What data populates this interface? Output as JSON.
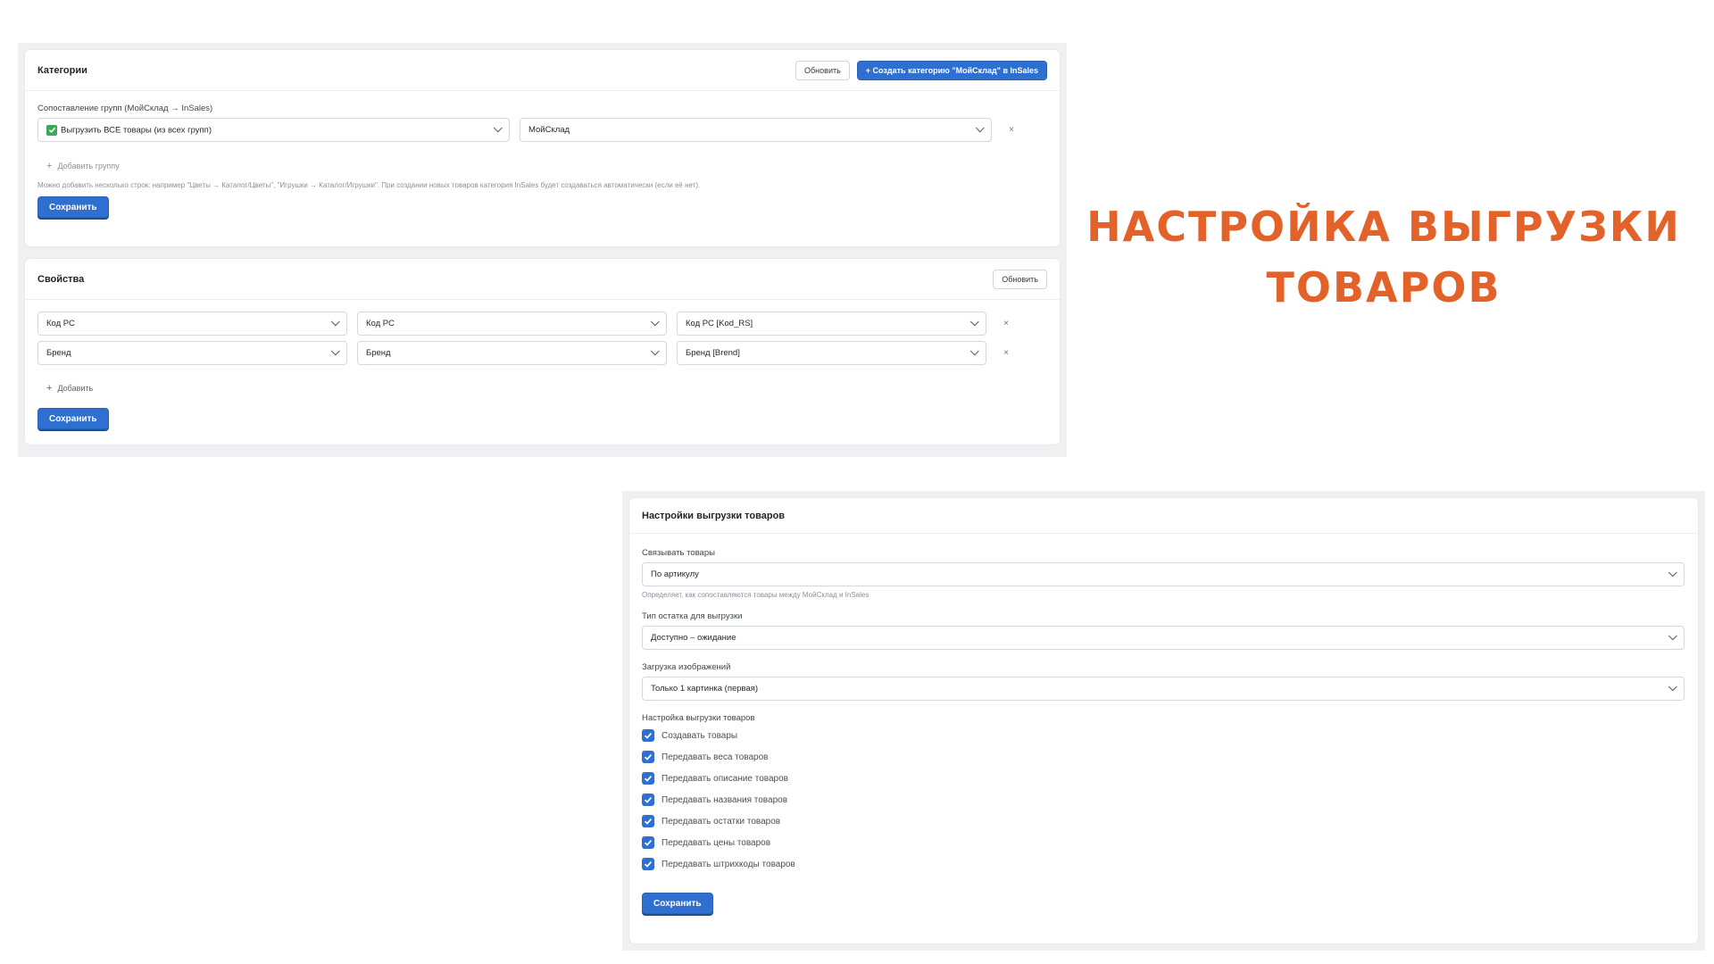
{
  "headline": {
    "line1": "НАСТРОЙКА ВЫГРУЗКИ",
    "line2": "ТОВАРОВ",
    "color": "#e2622a"
  },
  "categories": {
    "title": "Категории",
    "refresh_label": "Обновить",
    "create_label": "+ Создать категорию \"МойСклад\" в InSales",
    "mapping_label": "Сопоставление групп (МойСклад → InSales)",
    "source_select": "Выгрузить ВСЕ товары (из всех групп)",
    "target_select": "МойСклад",
    "remove_label": "×",
    "add_group_label": "Добавить группу",
    "hint": "Можно добавить несколько строк: например \"Цветы → Каталог/Цветы\", \"Игрушки → Каталог/Игрушки\". При создании новых товаров категория InSales будет создаваться автоматически (если её нет).",
    "save_label": "Сохранить"
  },
  "properties": {
    "title": "Свойства",
    "refresh_label": "Обновить",
    "rows": [
      {
        "a": "Код РС",
        "b": "Код РС",
        "c": "Код РС [Kod_RS]",
        "remove": "×"
      },
      {
        "a": "Бренд",
        "b": "Бренд",
        "c": "Бренд [Brend]",
        "remove": "×"
      }
    ],
    "add_label": "Добавить",
    "save_label": "Сохранить"
  },
  "export_settings": {
    "title": "Настройки выгрузки товаров",
    "link_label": "Связывать товары",
    "link_value": "По артикулу",
    "link_hint": "Определяет, как сопоставляются товары между МойСклад и InSales",
    "stock_label": "Тип остатка для выгрузки",
    "stock_value": "Доступно – ожидание",
    "images_label": "Загрузка изображений",
    "images_value": "Только 1 картинка (первая)",
    "options_label": "Настройка выгрузки товаров",
    "options": [
      {
        "label": "Создавать товары",
        "checked": true
      },
      {
        "label": "Передавать веса товаров",
        "checked": true
      },
      {
        "label": "Передавать описание товаров",
        "checked": true
      },
      {
        "label": "Передавать названия товаров",
        "checked": true
      },
      {
        "label": "Передавать остатки товаров",
        "checked": true
      },
      {
        "label": "Передавать цены товаров",
        "checked": true
      },
      {
        "label": "Передавать штрихкоды товаров",
        "checked": true
      }
    ],
    "save_label": "Сохранить"
  }
}
